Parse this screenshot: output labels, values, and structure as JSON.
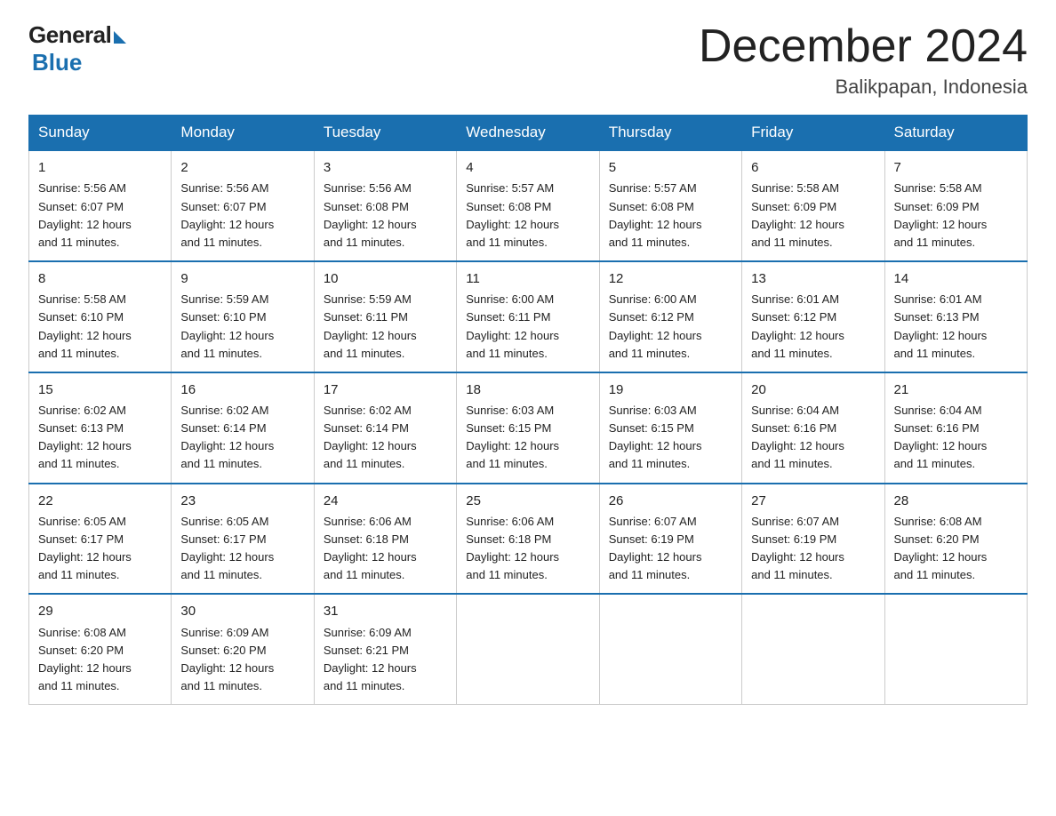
{
  "logo": {
    "general": "General",
    "blue": "Blue"
  },
  "header": {
    "month": "December 2024",
    "location": "Balikpapan, Indonesia"
  },
  "days_of_week": [
    "Sunday",
    "Monday",
    "Tuesday",
    "Wednesday",
    "Thursday",
    "Friday",
    "Saturday"
  ],
  "weeks": [
    [
      {
        "day": "1",
        "sunrise": "5:56 AM",
        "sunset": "6:07 PM",
        "daylight": "12 hours and 11 minutes."
      },
      {
        "day": "2",
        "sunrise": "5:56 AM",
        "sunset": "6:07 PM",
        "daylight": "12 hours and 11 minutes."
      },
      {
        "day": "3",
        "sunrise": "5:56 AM",
        "sunset": "6:08 PM",
        "daylight": "12 hours and 11 minutes."
      },
      {
        "day": "4",
        "sunrise": "5:57 AM",
        "sunset": "6:08 PM",
        "daylight": "12 hours and 11 minutes."
      },
      {
        "day": "5",
        "sunrise": "5:57 AM",
        "sunset": "6:08 PM",
        "daylight": "12 hours and 11 minutes."
      },
      {
        "day": "6",
        "sunrise": "5:58 AM",
        "sunset": "6:09 PM",
        "daylight": "12 hours and 11 minutes."
      },
      {
        "day": "7",
        "sunrise": "5:58 AM",
        "sunset": "6:09 PM",
        "daylight": "12 hours and 11 minutes."
      }
    ],
    [
      {
        "day": "8",
        "sunrise": "5:58 AM",
        "sunset": "6:10 PM",
        "daylight": "12 hours and 11 minutes."
      },
      {
        "day": "9",
        "sunrise": "5:59 AM",
        "sunset": "6:10 PM",
        "daylight": "12 hours and 11 minutes."
      },
      {
        "day": "10",
        "sunrise": "5:59 AM",
        "sunset": "6:11 PM",
        "daylight": "12 hours and 11 minutes."
      },
      {
        "day": "11",
        "sunrise": "6:00 AM",
        "sunset": "6:11 PM",
        "daylight": "12 hours and 11 minutes."
      },
      {
        "day": "12",
        "sunrise": "6:00 AM",
        "sunset": "6:12 PM",
        "daylight": "12 hours and 11 minutes."
      },
      {
        "day": "13",
        "sunrise": "6:01 AM",
        "sunset": "6:12 PM",
        "daylight": "12 hours and 11 minutes."
      },
      {
        "day": "14",
        "sunrise": "6:01 AM",
        "sunset": "6:13 PM",
        "daylight": "12 hours and 11 minutes."
      }
    ],
    [
      {
        "day": "15",
        "sunrise": "6:02 AM",
        "sunset": "6:13 PM",
        "daylight": "12 hours and 11 minutes."
      },
      {
        "day": "16",
        "sunrise": "6:02 AM",
        "sunset": "6:14 PM",
        "daylight": "12 hours and 11 minutes."
      },
      {
        "day": "17",
        "sunrise": "6:02 AM",
        "sunset": "6:14 PM",
        "daylight": "12 hours and 11 minutes."
      },
      {
        "day": "18",
        "sunrise": "6:03 AM",
        "sunset": "6:15 PM",
        "daylight": "12 hours and 11 minutes."
      },
      {
        "day": "19",
        "sunrise": "6:03 AM",
        "sunset": "6:15 PM",
        "daylight": "12 hours and 11 minutes."
      },
      {
        "day": "20",
        "sunrise": "6:04 AM",
        "sunset": "6:16 PM",
        "daylight": "12 hours and 11 minutes."
      },
      {
        "day": "21",
        "sunrise": "6:04 AM",
        "sunset": "6:16 PM",
        "daylight": "12 hours and 11 minutes."
      }
    ],
    [
      {
        "day": "22",
        "sunrise": "6:05 AM",
        "sunset": "6:17 PM",
        "daylight": "12 hours and 11 minutes."
      },
      {
        "day": "23",
        "sunrise": "6:05 AM",
        "sunset": "6:17 PM",
        "daylight": "12 hours and 11 minutes."
      },
      {
        "day": "24",
        "sunrise": "6:06 AM",
        "sunset": "6:18 PM",
        "daylight": "12 hours and 11 minutes."
      },
      {
        "day": "25",
        "sunrise": "6:06 AM",
        "sunset": "6:18 PM",
        "daylight": "12 hours and 11 minutes."
      },
      {
        "day": "26",
        "sunrise": "6:07 AM",
        "sunset": "6:19 PM",
        "daylight": "12 hours and 11 minutes."
      },
      {
        "day": "27",
        "sunrise": "6:07 AM",
        "sunset": "6:19 PM",
        "daylight": "12 hours and 11 minutes."
      },
      {
        "day": "28",
        "sunrise": "6:08 AM",
        "sunset": "6:20 PM",
        "daylight": "12 hours and 11 minutes."
      }
    ],
    [
      {
        "day": "29",
        "sunrise": "6:08 AM",
        "sunset": "6:20 PM",
        "daylight": "12 hours and 11 minutes."
      },
      {
        "day": "30",
        "sunrise": "6:09 AM",
        "sunset": "6:20 PM",
        "daylight": "12 hours and 11 minutes."
      },
      {
        "day": "31",
        "sunrise": "6:09 AM",
        "sunset": "6:21 PM",
        "daylight": "12 hours and 11 minutes."
      },
      null,
      null,
      null,
      null
    ]
  ],
  "labels": {
    "sunrise": "Sunrise:",
    "sunset": "Sunset:",
    "daylight": "Daylight:"
  }
}
